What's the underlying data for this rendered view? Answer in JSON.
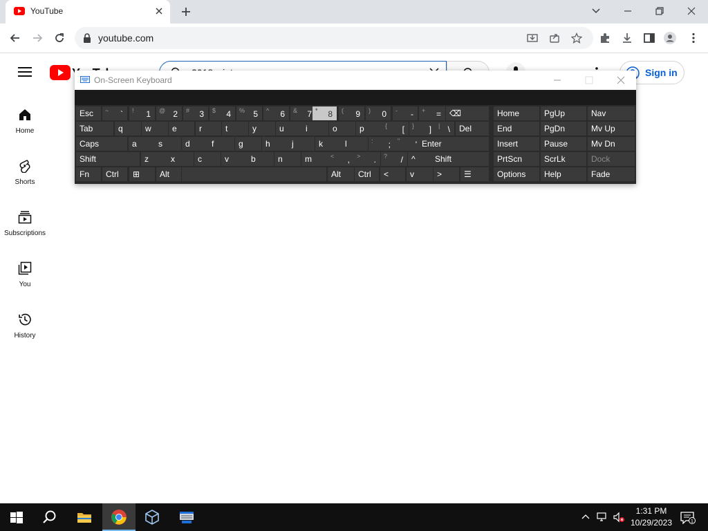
{
  "browser": {
    "tab_title": "YouTube",
    "url": "youtube.com"
  },
  "youtube": {
    "logo_text": "YouTube",
    "search_text": "2018 wint",
    "signin_label": "Sign in",
    "guide": [
      {
        "label": "Home"
      },
      {
        "label": "Shorts"
      },
      {
        "label": "Subscriptions"
      },
      {
        "label": "You"
      },
      {
        "label": "History"
      }
    ]
  },
  "osk": {
    "title": "On-Screen Keyboard",
    "row1": [
      {
        "mn": "Esc"
      },
      {
        "sh": "~",
        "mn": "`"
      },
      {
        "sh": "!",
        "mn": "1"
      },
      {
        "sh": "@",
        "mn": "2"
      },
      {
        "sh": "#",
        "mn": "3"
      },
      {
        "sh": "$",
        "mn": "4"
      },
      {
        "sh": "%",
        "mn": "5"
      },
      {
        "sh": "^",
        "mn": "6"
      },
      {
        "sh": "&",
        "mn": "7"
      },
      {
        "sh": "*",
        "mn": "8"
      },
      {
        "sh": "(",
        "mn": "9"
      },
      {
        "sh": ")",
        "mn": "0"
      },
      {
        "sh": "-",
        "mn": "-"
      },
      {
        "sh": "+",
        "mn": "="
      },
      {
        "mn": "⌫"
      }
    ],
    "row2": [
      {
        "mn": "Tab"
      },
      {
        "mn": "q"
      },
      {
        "mn": "w"
      },
      {
        "mn": "e"
      },
      {
        "mn": "r"
      },
      {
        "mn": "t"
      },
      {
        "mn": "y"
      },
      {
        "mn": "u"
      },
      {
        "mn": "i"
      },
      {
        "mn": "o"
      },
      {
        "mn": "p"
      },
      {
        "sh": "{",
        "mn": "["
      },
      {
        "sh": "}",
        "mn": "]"
      },
      {
        "sh": "|",
        "mn": "\\"
      },
      {
        "mn": "Del"
      }
    ],
    "row3": [
      {
        "mn": "Caps"
      },
      {
        "mn": "a"
      },
      {
        "mn": "s"
      },
      {
        "mn": "d"
      },
      {
        "mn": "f"
      },
      {
        "mn": "g"
      },
      {
        "mn": "h"
      },
      {
        "mn": "j"
      },
      {
        "mn": "k"
      },
      {
        "mn": "l"
      },
      {
        "sh": ":",
        "mn": ";"
      },
      {
        "sh": "\"",
        "mn": "'"
      },
      {
        "mn": "Enter"
      }
    ],
    "row4": [
      {
        "mn": "Shift"
      },
      {
        "mn": "z"
      },
      {
        "mn": "x"
      },
      {
        "mn": "c"
      },
      {
        "mn": "v"
      },
      {
        "mn": "b"
      },
      {
        "mn": "n"
      },
      {
        "mn": "m"
      },
      {
        "sh": "<",
        "mn": ","
      },
      {
        "sh": ">",
        "mn": "."
      },
      {
        "sh": "?",
        "mn": "/"
      },
      {
        "mn": "^"
      },
      {
        "mn": "Shift"
      }
    ],
    "row5": [
      {
        "mn": "Fn"
      },
      {
        "mn": "Ctrl"
      },
      {
        "mn": "⊞"
      },
      {
        "mn": "Alt"
      },
      {
        "mn": ""
      },
      {
        "mn": "Alt"
      },
      {
        "mn": "Ctrl"
      },
      {
        "mn": "<"
      },
      {
        "mn": "v"
      },
      {
        "mn": ">"
      },
      {
        "mn": "☰"
      }
    ],
    "nav": [
      [
        "Home",
        "PgUp",
        "Nav"
      ],
      [
        "End",
        "PgDn",
        "Mv Up"
      ],
      [
        "Insert",
        "Pause",
        "Mv Dn"
      ],
      [
        "PrtScn",
        "ScrLk",
        "Dock"
      ],
      [
        "Options",
        "Help",
        "Fade"
      ]
    ]
  },
  "taskbar": {
    "time": "1:31 PM",
    "date": "10/29/2023",
    "notification_count": "1"
  }
}
